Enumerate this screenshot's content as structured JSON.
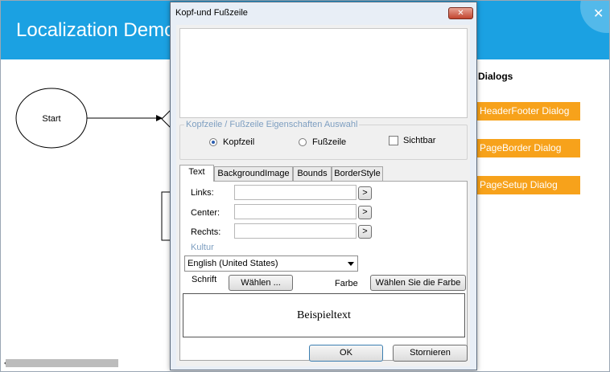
{
  "app": {
    "title": "Localization Demo",
    "close_glyph": "✕"
  },
  "diagram": {
    "start_label": "Start",
    "right_panel_title": "Dialogs",
    "buttons": [
      "HeaderFooter Dialog",
      "PageBorder Dialog",
      "PageSetup Dialog"
    ],
    "accent_color": "#1ba1e2",
    "button_color": "#f7a21b"
  },
  "dialog": {
    "title": "Kopf-und Fußzeile",
    "close_glyph": "✕",
    "group_legend": "Kopfzeile / Fußzeile Eigenschaften Auswahl",
    "radios": {
      "header": "Kopfzeil",
      "footer": "Fußzeile",
      "selected": "header"
    },
    "visible_checkbox": {
      "label": "Sichtbar",
      "checked": false
    },
    "tabs": [
      "Text",
      "BackgroundImage",
      "Bounds",
      "BorderStyle"
    ],
    "active_tab": "Text",
    "fields": {
      "left": {
        "label": "Links:",
        "value": ""
      },
      "center": {
        "label": "Center:",
        "value": ""
      },
      "right": {
        "label": "Rechts:",
        "value": ""
      },
      "browse_glyph": ">"
    },
    "culture": {
      "label": "Kultur",
      "selected": "English (United States)"
    },
    "font": {
      "label": "Schrift",
      "button": "Wählen ..."
    },
    "color": {
      "label": "Farbe",
      "button": "Wählen Sie die Farbe"
    },
    "sample_text": "Beispieltext",
    "ok": "OK",
    "cancel": "Stornieren"
  }
}
